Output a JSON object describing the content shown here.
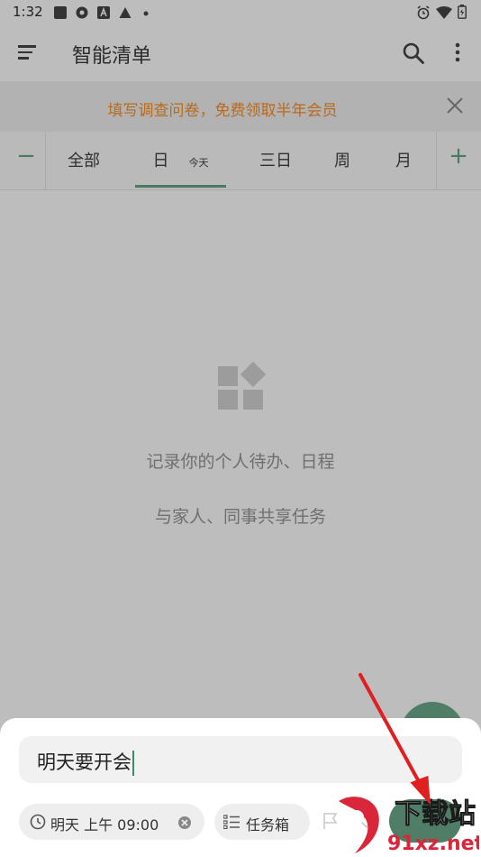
{
  "status_bar": {
    "time": "1:32"
  },
  "app_bar": {
    "title": "智能清单"
  },
  "banner": {
    "text": "填写调查问卷，免费领取半年会员"
  },
  "tabs": {
    "minus": "−",
    "plus": "+",
    "items": [
      {
        "label": "全部"
      },
      {
        "label": "日",
        "sub": "今天"
      },
      {
        "label": "三日"
      },
      {
        "label": "周"
      },
      {
        "label": "月"
      }
    ]
  },
  "empty_state": {
    "line1": "记录你的个人待办、日程",
    "line2": "与家人、同事共享任务"
  },
  "new_task": {
    "input_value": "明天要开会",
    "date_chip": "明天 上午 09:00",
    "list_chip": "任务箱"
  },
  "watermark": {
    "top": "下载站",
    "bottom": "91xz.net"
  },
  "colors": {
    "accent": "#4f7d66",
    "banner_text": "#b86a1e",
    "arrow": "#e02020"
  }
}
